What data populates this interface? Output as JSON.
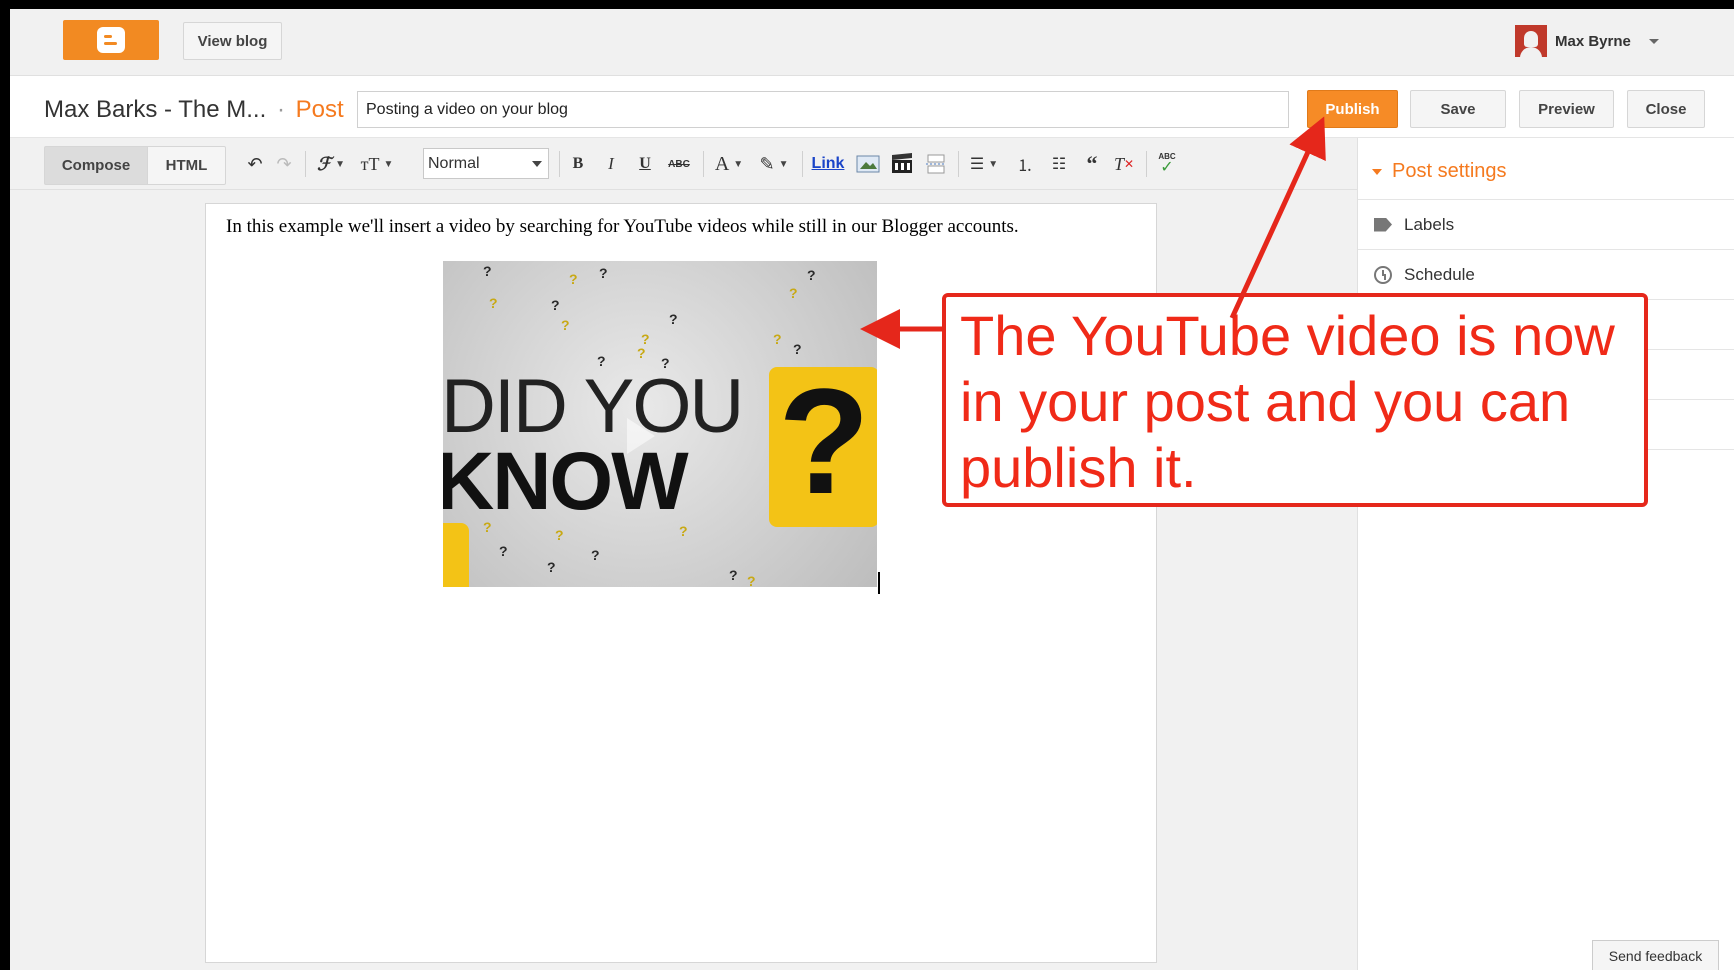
{
  "topbar": {
    "view_blog": "View blog",
    "user_name": "Max Byrne"
  },
  "titlebar": {
    "blog_name": "Max Barks - The M...",
    "separator": "·",
    "section": "Post",
    "post_title": "Posting a video on your blog",
    "publish": "Publish",
    "save": "Save",
    "preview": "Preview",
    "close": "Close"
  },
  "toolbar": {
    "compose": "Compose",
    "html": "HTML",
    "font_size_value": "Normal",
    "bold": "B",
    "italic": "I",
    "underline": "U",
    "strike": "ABC",
    "text_color": "A",
    "link": "Link",
    "spell": "ABC"
  },
  "editor": {
    "body_text": "In this example we'll insert a video by searching for YouTube videos while still in our Blogger accounts.",
    "video_line1": "DID YOU",
    "video_line2": "KNOW",
    "video_mark": "?"
  },
  "sidebar": {
    "heading": "Post settings",
    "items": [
      {
        "label": "Labels",
        "icon": "tag-icon"
      },
      {
        "label": "Schedule",
        "icon": "clock-icon"
      }
    ]
  },
  "annotation": {
    "text": "The YouTube video is now in your post and you can publish it.",
    "color": "#f02a18"
  },
  "feedback": "Send feedback",
  "colors": {
    "brand_orange": "#f28a22",
    "publish": "#f68b26",
    "accent_text": "#f57a1f"
  }
}
